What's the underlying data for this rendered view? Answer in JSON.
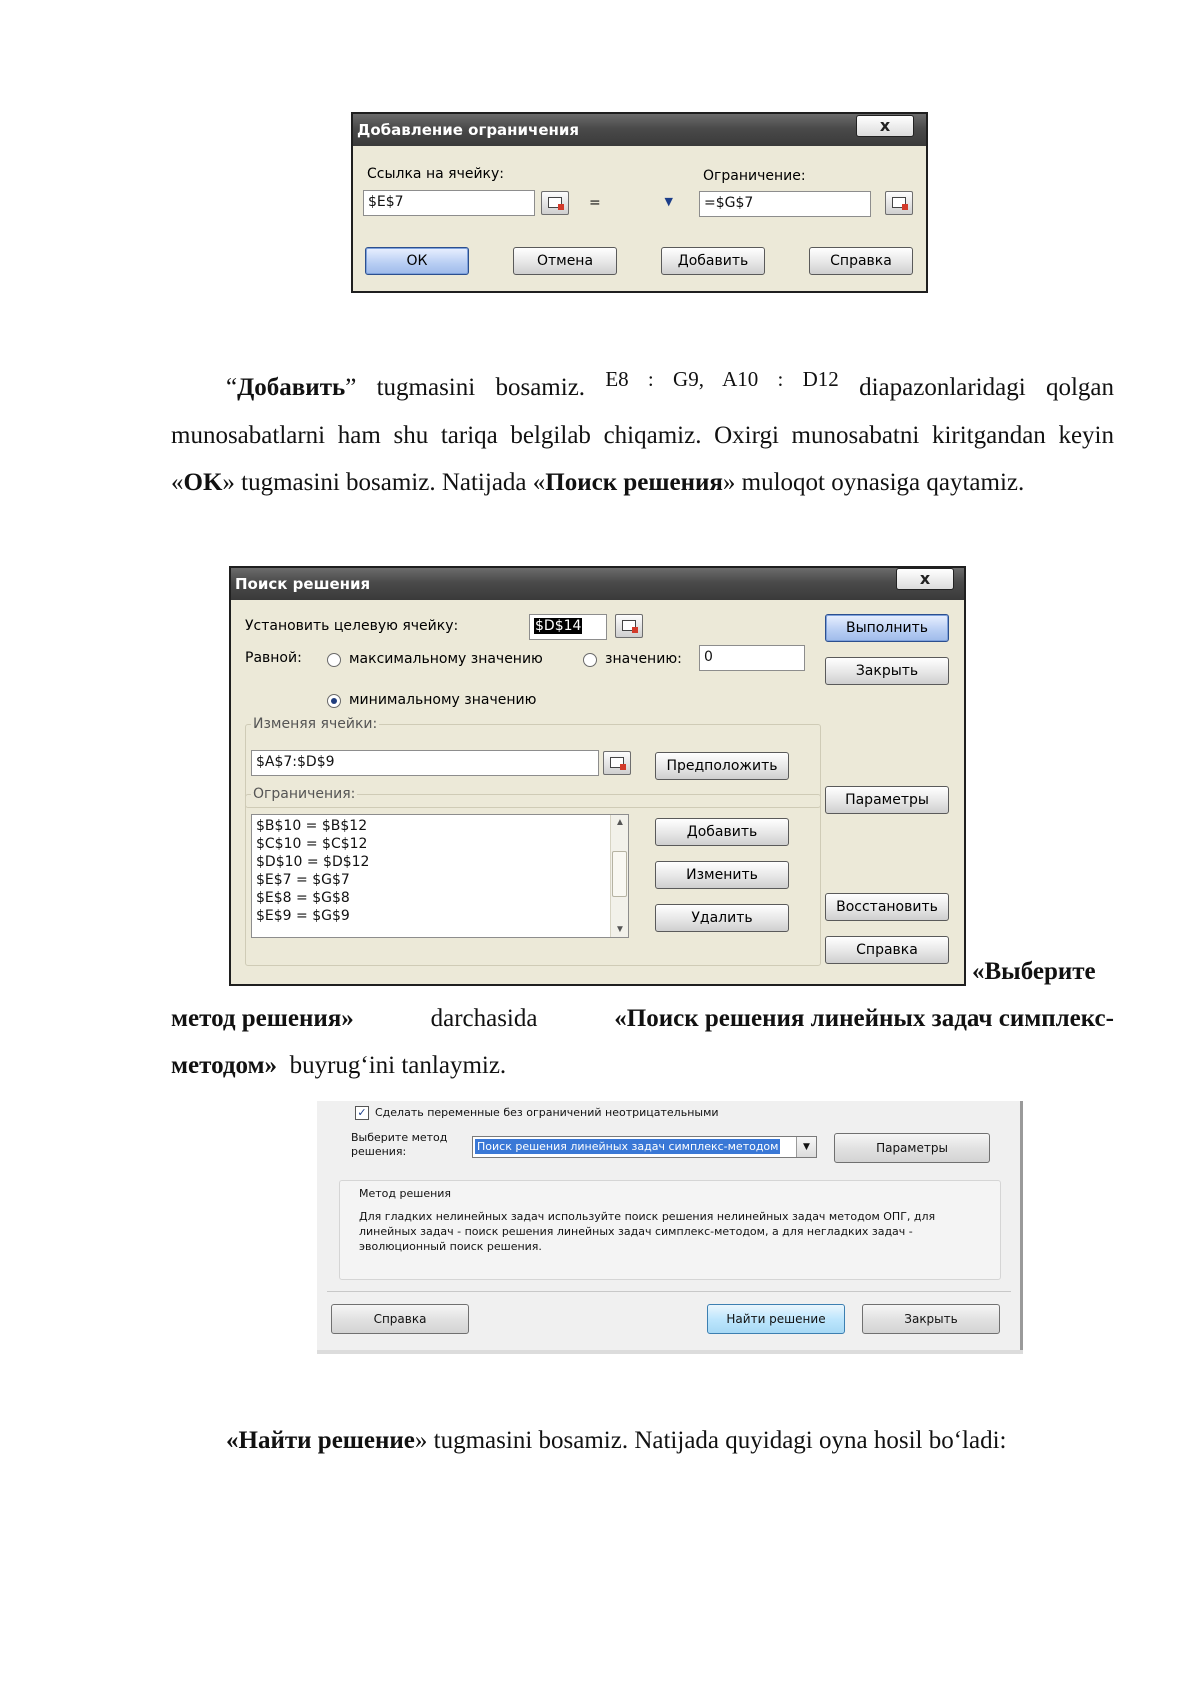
{
  "constraint_dialog": {
    "title": "Добавление ограничения",
    "close_glyph": "x",
    "cell_ref_label": "Ссылка на ячейку:",
    "cell_ref_value": "$E$7",
    "operator": "=",
    "constraint_label": "Ограничение:",
    "constraint_value": "=$G$7",
    "buttons": {
      "ok": "ОК",
      "cancel": "Отмена",
      "add": "Добавить",
      "help": "Справка"
    }
  },
  "para1": {
    "p1_a": "“",
    "p1_b": "Добавить",
    "p1_c": "” tugmasini bosamiz.",
    "p1_math": "E8 : G9,  A10 : D12",
    "p1_d": "diapazonlaridagi qolgan munosabatlarni ham shu tariqa belgilab chiqamiz. Oxirgi munosabatni kiritgandan keyin «",
    "p1_e": "OK",
    "p1_f": "» tugmasini bosamiz.  Natijada «",
    "p1_g": "Поиск решения",
    "p1_h": "» muloqot oynasiga qaytamiz."
  },
  "solver_dialog": {
    "title": "Поиск решения",
    "close_glyph": "x",
    "target_label": "Установить целевую ячейку:",
    "target_value": "$D$14",
    "equal_label": "Равной:",
    "radio_max": "максимальному значению",
    "radio_value": "значению:",
    "value_input": "0",
    "radio_min": "минимальному значению",
    "changing_label": "Изменяя ячейки:",
    "changing_value": "$A$7:$D$9",
    "guess_button": "Предположить",
    "constraints_label": "Ограничения:",
    "constraints": [
      "$B$10 = $B$12",
      "$C$10 = $C$12",
      "$D$10 = $D$12",
      "$E$7 = $G$7",
      "$E$8 = $G$8",
      "$E$9 = $G$9"
    ],
    "add_button": "Добавить",
    "change_button": "Изменить",
    "delete_button": "Удалить",
    "run_button": "Выполнить",
    "close_button": "Закрыть",
    "params_button": "Параметры",
    "restore_button": "Восстановить",
    "help_button": "Справка"
  },
  "para2": {
    "p2_a": "«Выберите",
    "p2_b": "метод решения»",
    "p2_c": "darchasida",
    "p2_d": "«Поиск решения линейных задач симплекс-",
    "p2_e": "методом»",
    "p2_f": "buyrug‘ini tanlaymiz."
  },
  "method_dialog": {
    "nonneg_checkbox": "Сделать переменные без ограничений неотрицательными",
    "select_label": "Выберите метод решения:",
    "select_value": "Поиск решения линейных задач симплекс-методом",
    "params_button": "Параметры",
    "group_title": "Метод решения",
    "description": "Для гладких нелинейных задач используйте поиск решения нелинейных задач методом ОПГ, для линейных задач - поиск решения линейных задач симплекс-методом, а для негладких задач - эволюционный поиск решения.",
    "help_button": "Справка",
    "find_button": "Найти решение",
    "close_button": "Закрыть"
  },
  "para3": {
    "p3_a": "«Н",
    "p3_b": "айти решение",
    "p3_c": "» tugmasini bosamiz. Natijada quyidagi oyna hosil bo‘ladi:"
  }
}
